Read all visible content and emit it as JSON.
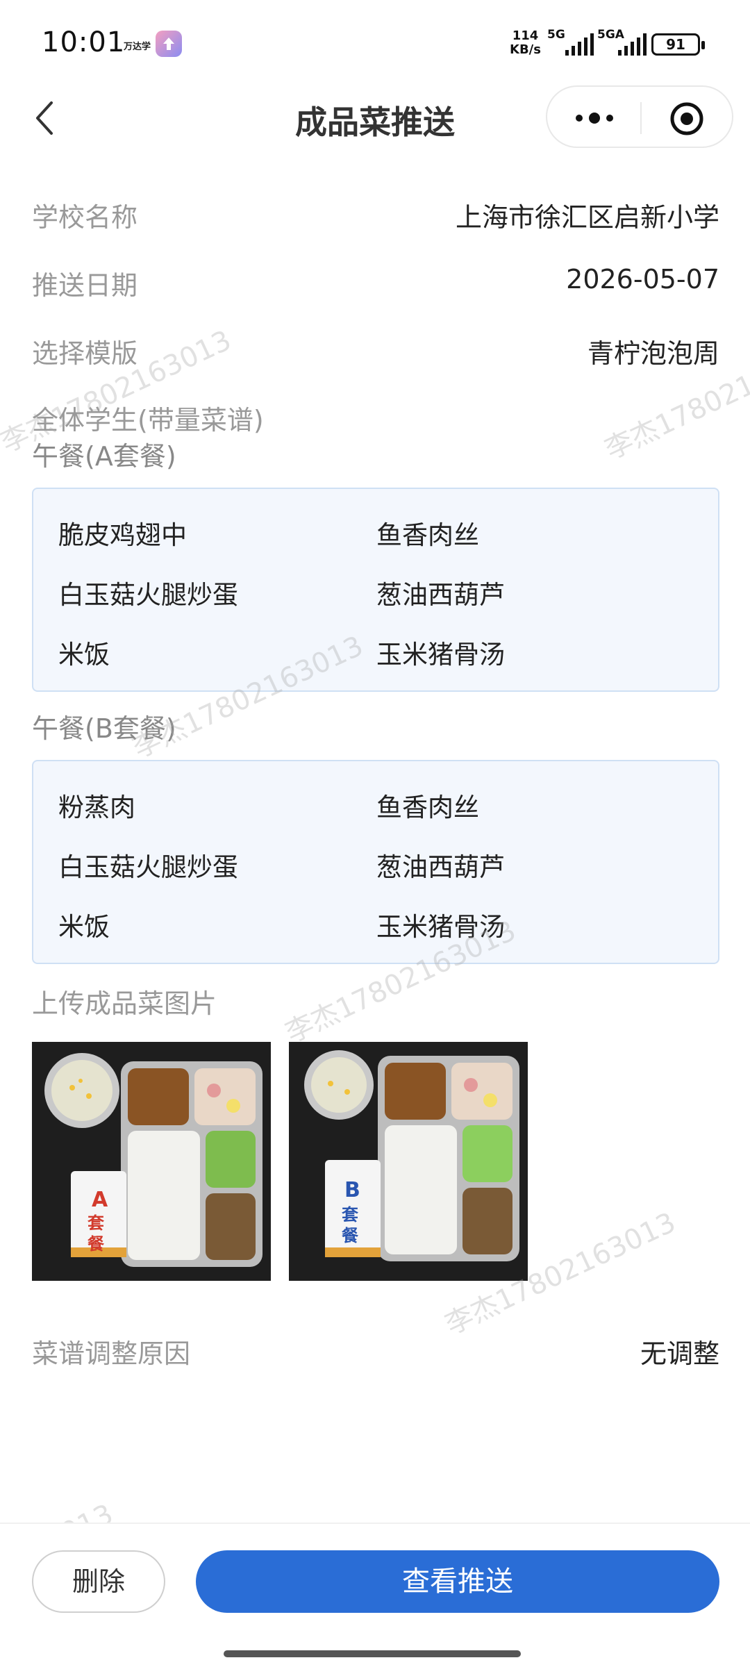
{
  "status_bar": {
    "time": "10:01",
    "app_label": "万达学",
    "net_speed_value": "114",
    "net_speed_unit": "KB/s",
    "signal1": "5G",
    "signal2": "5GA",
    "battery": "91"
  },
  "nav": {
    "title": "成品菜推送"
  },
  "info": {
    "school_label": "学校名称",
    "school_value": "上海市徐汇区启新小学",
    "date_label": "推送日期",
    "date_value": "2026-05-07",
    "template_label": "选择模版",
    "template_value": "青柠泡泡周"
  },
  "audience_title": "全体学生(带量菜谱)",
  "menu_a": {
    "title": "午餐(A套餐)",
    "items": [
      "脆皮鸡翅中",
      "鱼香肉丝",
      "白玉菇火腿炒蛋",
      "葱油西葫芦",
      "米饭",
      "玉米猪骨汤"
    ]
  },
  "menu_b": {
    "title": "午餐(B套餐)",
    "items": [
      "粉蒸肉",
      "鱼香肉丝",
      "白玉菇火腿炒蛋",
      "葱油西葫芦",
      "米饭",
      "玉米猪骨汤"
    ]
  },
  "photos": {
    "title": "上传成品菜图片",
    "a_card_letter": "A",
    "a_card_text": "套餐",
    "b_card_letter": "B",
    "b_card_text": "套餐"
  },
  "adjust": {
    "label": "菜谱调整原因",
    "value": "无调整"
  },
  "footer": {
    "delete_label": "删除",
    "view_label": "查看推送"
  },
  "watermark_text": "李杰17802163013",
  "colors": {
    "primary": "#2a6dd6",
    "menu_bg": "#f3f7fd",
    "menu_border": "#cfe0f4",
    "label_gray": "#999999"
  }
}
